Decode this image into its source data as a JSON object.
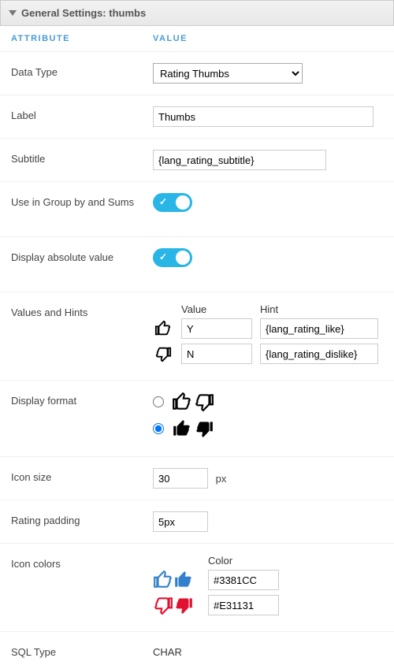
{
  "panel": {
    "title": "General Settings: thumbs"
  },
  "columns": {
    "attribute": "ATTRIBUTE",
    "value": "VALUE"
  },
  "rows": {
    "data_type": {
      "label": "Data Type",
      "selected": "Rating Thumbs"
    },
    "label": {
      "label": "Label",
      "value": "Thumbs"
    },
    "subtitle": {
      "label": "Subtitle",
      "value": "{lang_rating_subtitle}"
    },
    "group_by": {
      "label": "Use in Group by and Sums",
      "on": true
    },
    "absolute": {
      "label": "Display absolute value",
      "on": true
    },
    "values_hints": {
      "label": "Values and Hints",
      "col_value": "Value",
      "col_hint": "Hint",
      "items": [
        {
          "icon": "thumb-up-outline",
          "value": "Y",
          "hint": "{lang_rating_like}"
        },
        {
          "icon": "thumb-down-outline",
          "value": "N",
          "hint": "{lang_rating_dislike}"
        }
      ]
    },
    "display_format": {
      "label": "Display format",
      "options": [
        {
          "icon_up": "thumb-up-outline",
          "icon_down": "thumb-down-outline",
          "selected": false
        },
        {
          "icon_up": "thumb-up-solid",
          "icon_down": "thumb-down-solid",
          "selected": true
        }
      ]
    },
    "icon_size": {
      "label": "Icon size",
      "value": "30",
      "unit": "px"
    },
    "rating_padding": {
      "label": "Rating padding",
      "value": "5px"
    },
    "icon_colors": {
      "label": "Icon colors",
      "col_color": "Color",
      "items": [
        {
          "icons": [
            "thumb-up-outline",
            "thumb-up-solid"
          ],
          "color": "#3381CC"
        },
        {
          "icons": [
            "thumb-down-outline",
            "thumb-down-solid"
          ],
          "color": "#E31131"
        }
      ]
    },
    "sql_type": {
      "label": "SQL Type",
      "value": "CHAR"
    }
  }
}
